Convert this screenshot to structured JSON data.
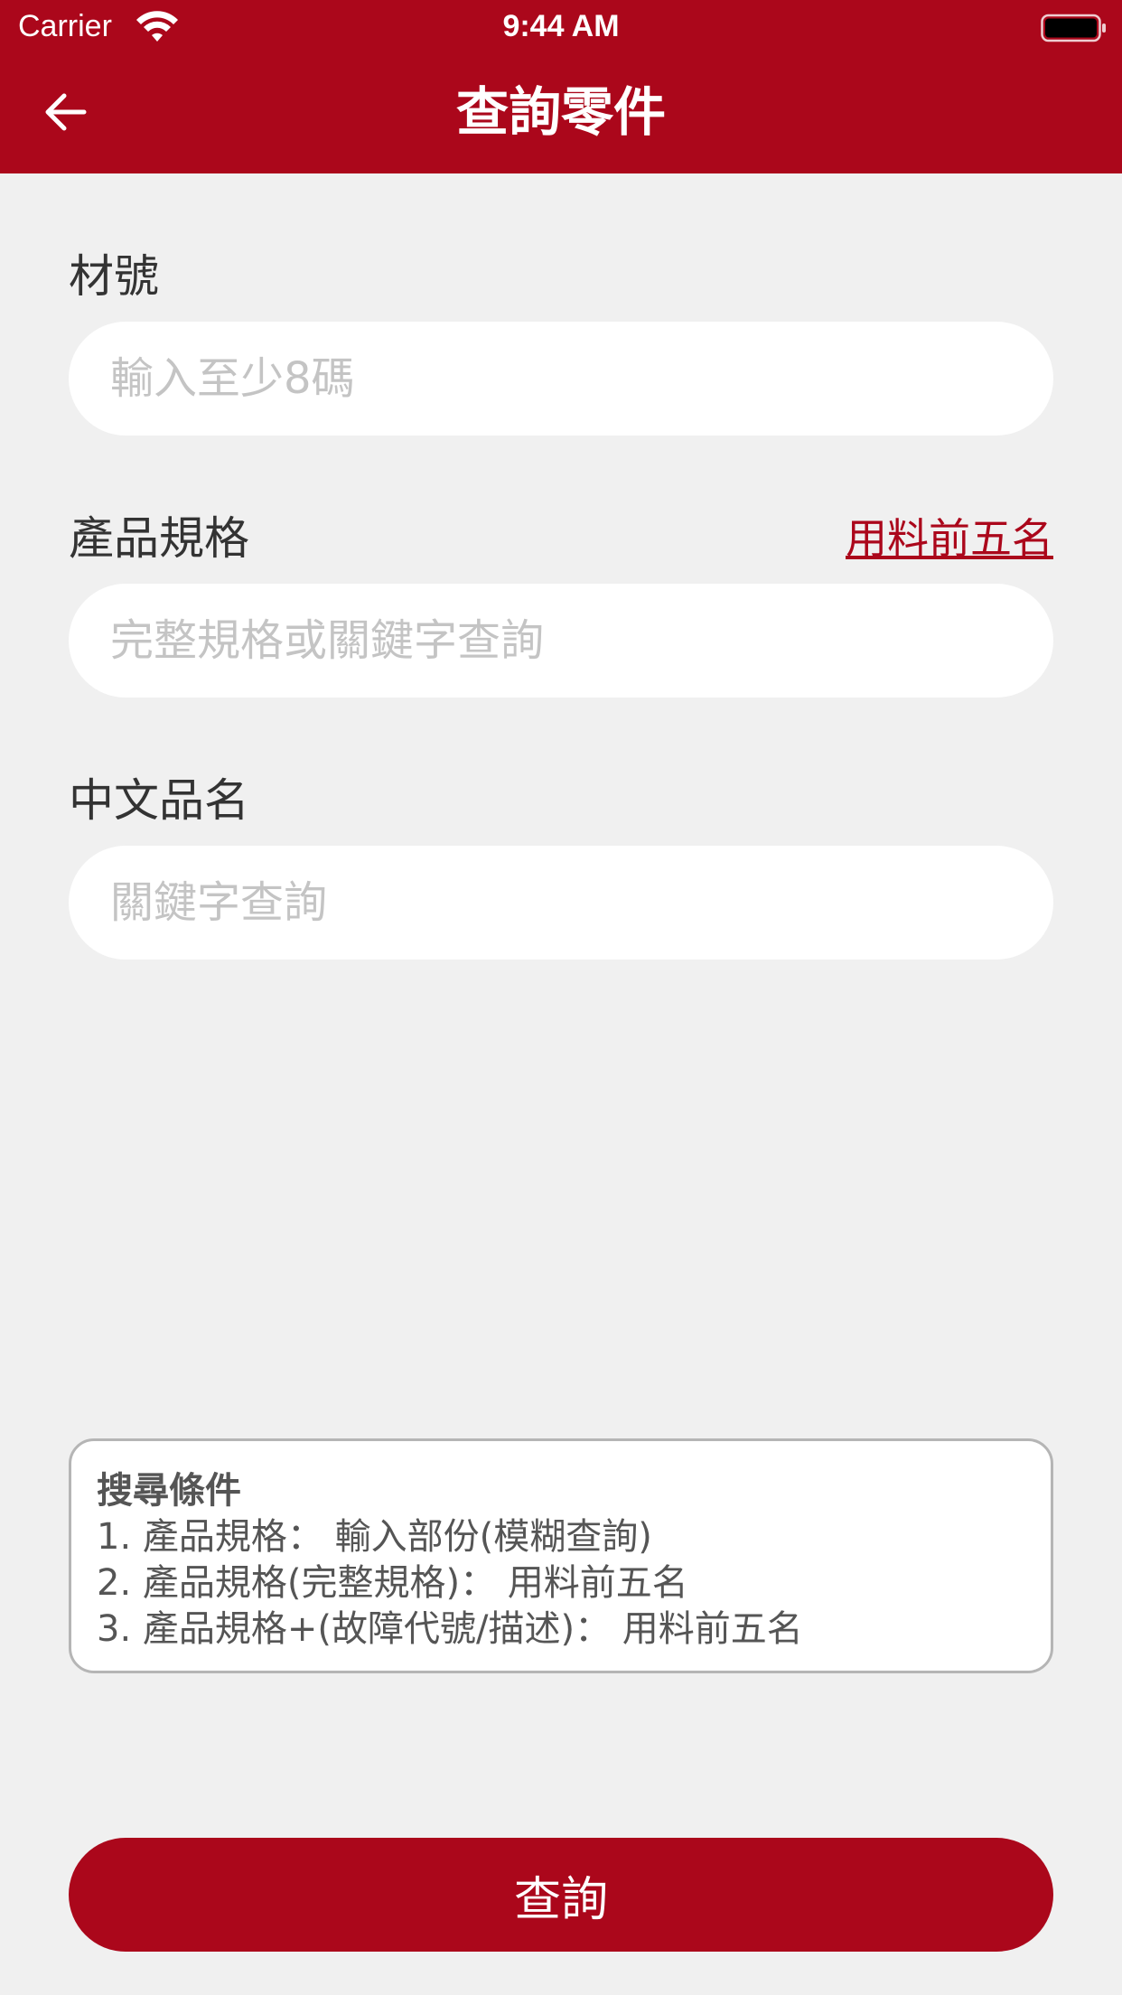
{
  "status_bar": {
    "carrier": "Carrier",
    "time": "9:44 AM"
  },
  "header": {
    "title": "查詢零件",
    "back_icon": "arrow-left-icon"
  },
  "form": {
    "part_number": {
      "label": "材號",
      "placeholder": "輸入至少8碼",
      "value": ""
    },
    "product_spec": {
      "label": "產品規格",
      "link": "用料前五名",
      "placeholder": "完整規格或關鍵字查詢",
      "value": ""
    },
    "chinese_name": {
      "label": "中文品名",
      "placeholder": "關鍵字查詢",
      "value": ""
    }
  },
  "search_conditions": {
    "title": "搜尋條件",
    "lines": [
      "1. 產品規格：  輸入部份(模糊查詢)",
      "2. 產品規格(完整規格)：  用料前五名",
      "3. 產品規格+(故障代號/描述)：  用料前五名"
    ]
  },
  "query_button": {
    "label": "查詢"
  },
  "colors": {
    "brand": "#ab071b",
    "background": "#f0f0f0",
    "placeholder": "#c4c4c4"
  }
}
